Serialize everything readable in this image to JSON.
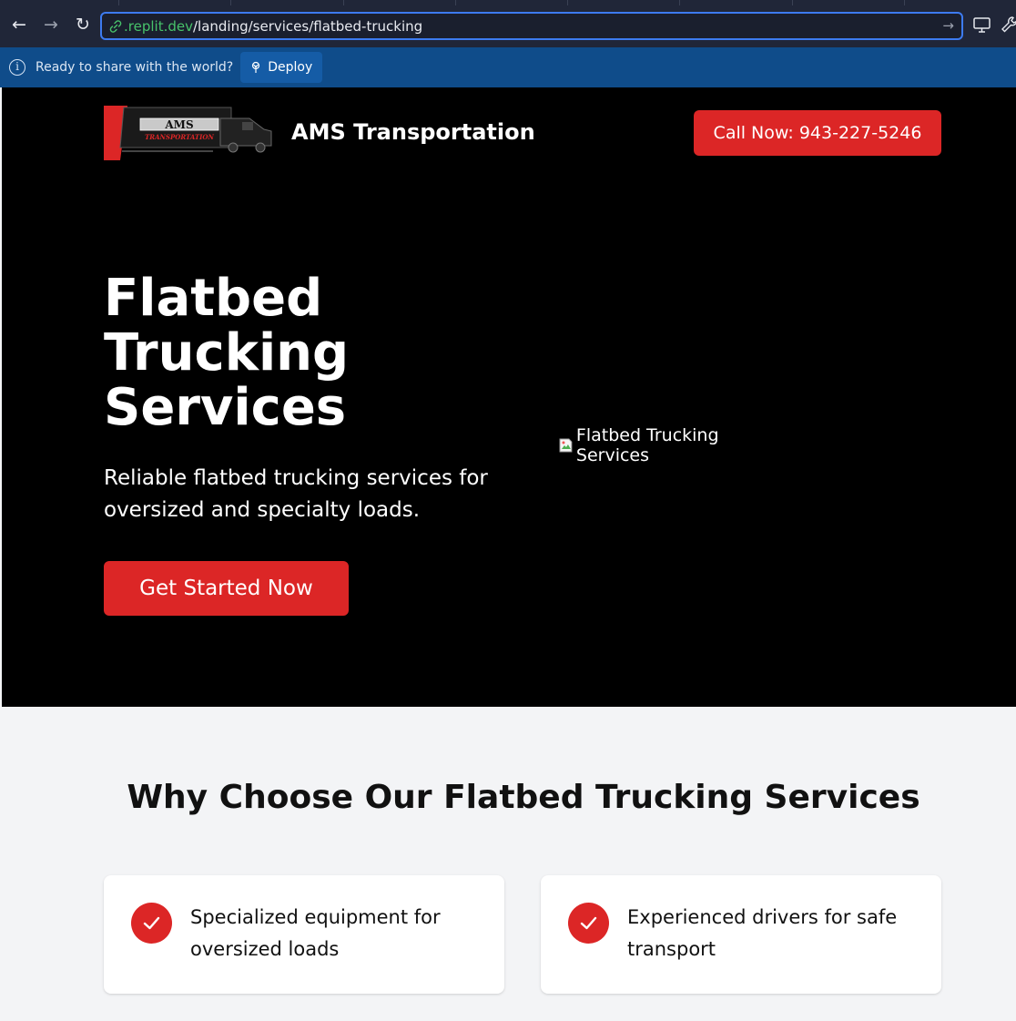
{
  "browser": {
    "url_domain": ".replit.dev",
    "url_path": "/landing/services/flatbed-trucking"
  },
  "replit_bar": {
    "message": "Ready to share with the world?",
    "deploy_label": "Deploy"
  },
  "header": {
    "logo_text": "AMS",
    "logo_subtext": "TRANSPORTATION",
    "brand_name": "AMS Transportation",
    "call_button": "Call Now: 943-227-5246"
  },
  "hero": {
    "title": "Flatbed Trucking Services",
    "subtitle": "Reliable flatbed trucking services for oversized and specialty loads.",
    "cta": "Get Started Now",
    "image_alt": "Flatbed Trucking Services"
  },
  "why": {
    "title": "Why Choose Our Flatbed Trucking Services",
    "items": [
      {
        "text": "Specialized equipment for oversized loads"
      },
      {
        "text": "Experienced drivers for safe transport"
      }
    ]
  },
  "colors": {
    "accent": "#dc2626",
    "hero_bg": "#000000",
    "section_bg": "#f3f4f6"
  }
}
